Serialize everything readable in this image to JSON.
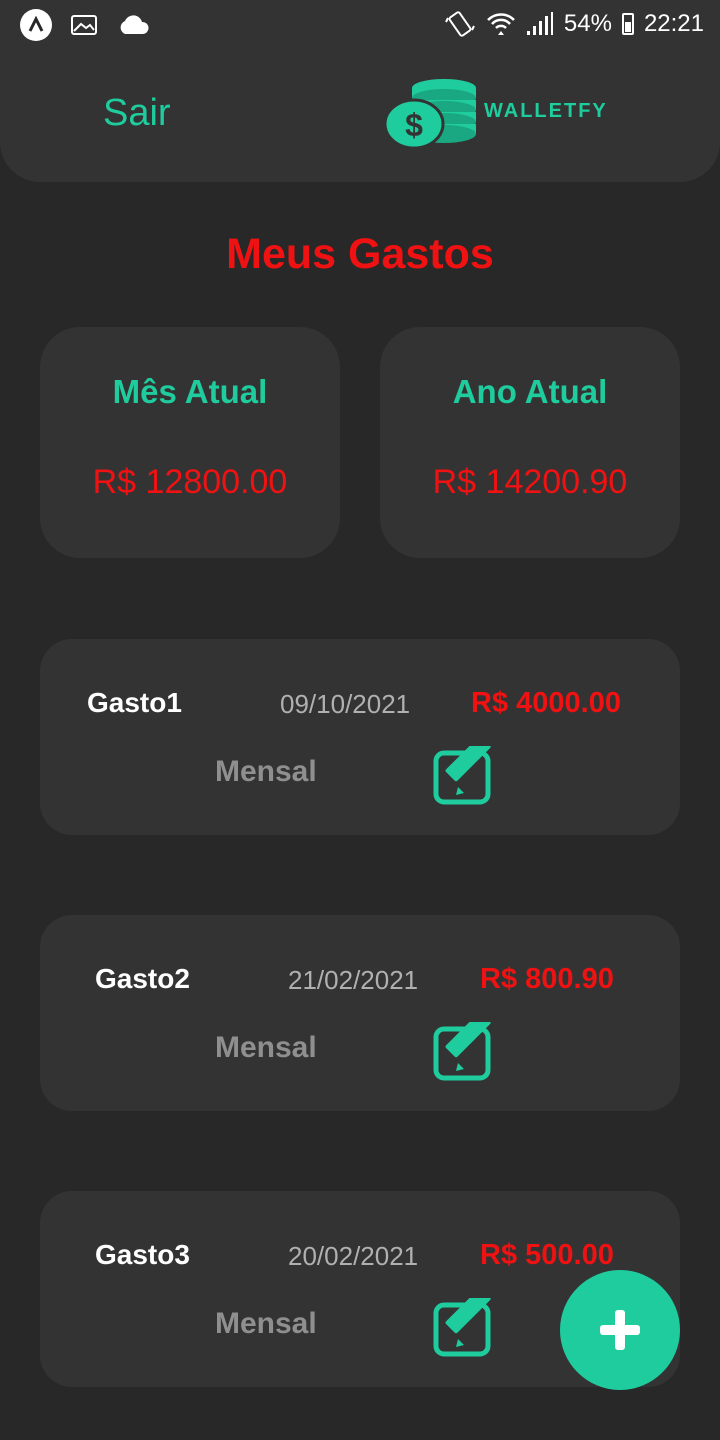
{
  "status_bar": {
    "battery": "54%",
    "time": "22:21",
    "icons": [
      "app-icon",
      "image-icon",
      "cloud-icon",
      "vibrate-icon",
      "wifi-icon",
      "signal-icon",
      "battery-icon"
    ]
  },
  "header": {
    "logout_label": "Sair",
    "logo_text": "WALLETFY"
  },
  "page_title": "Meus Gastos",
  "summary": [
    {
      "label": "Mês Atual",
      "value": "R$ 12800.00"
    },
    {
      "label": "Ano Atual",
      "value": "R$ 14200.90"
    }
  ],
  "expenses": [
    {
      "name": "Gasto1",
      "date": "09/10/2021",
      "amount": "R$ 4000.00",
      "period": "Mensal"
    },
    {
      "name": "Gasto2",
      "date": "21/02/2021",
      "amount": "R$ 800.90",
      "period": "Mensal"
    },
    {
      "name": "Gasto3",
      "date": "20/02/2021",
      "amount": "R$ 500.00",
      "period": "Mensal"
    }
  ],
  "colors": {
    "accent": "#1fcc9d",
    "danger": "#f01212",
    "background": "#282828",
    "card": "#333333"
  },
  "fab_icon": "plus-icon"
}
